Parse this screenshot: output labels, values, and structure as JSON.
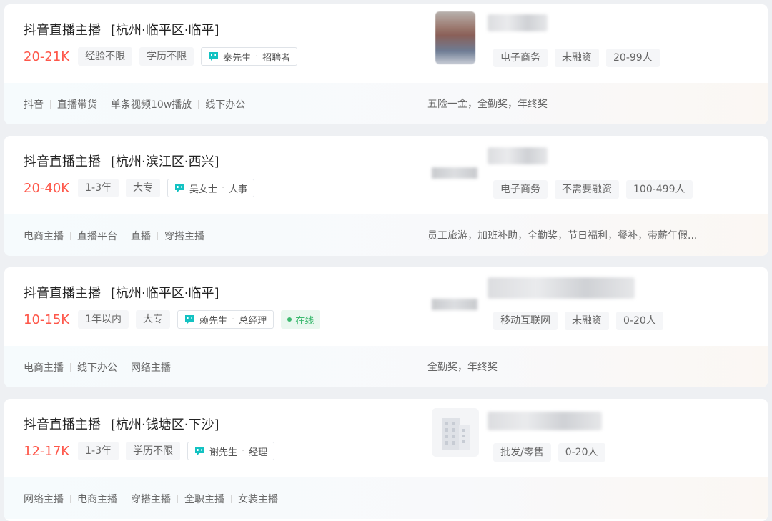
{
  "jobs": [
    {
      "title": "抖音直播主播",
      "location": "[杭州·临平区·临平]",
      "salary": "20-21K",
      "tags": [
        "经验不限",
        "学历不限"
      ],
      "recruiter": {
        "name": "秦先生",
        "role": "招聘者"
      },
      "online": null,
      "company": {
        "logo": "person-photo-blurred",
        "tags": [
          "电子商务",
          "未融资",
          "20-99人"
        ]
      },
      "skills": [
        "抖音",
        "直播带货",
        "单条视频10w播放",
        "线下办公"
      ],
      "benefits": "五险一金，全勤奖，年终奖"
    },
    {
      "title": "抖音直播主播",
      "location": "[杭州·滨江区·西兴]",
      "salary": "20-40K",
      "tags": [
        "1-3年",
        "大专"
      ],
      "recruiter": {
        "name": "吴女士",
        "role": "人事"
      },
      "online": null,
      "company": {
        "logo": "blurred-logo",
        "tags": [
          "电子商务",
          "不需要融资",
          "100-499人"
        ]
      },
      "skills": [
        "电商主播",
        "直播平台",
        "直播",
        "穿搭主播"
      ],
      "benefits": "员工旅游，加班补助，全勤奖，节日福利，餐补，带薪年假..."
    },
    {
      "title": "抖音直播主播",
      "location": "[杭州·临平区·临平]",
      "salary": "10-15K",
      "tags": [
        "1年以内",
        "大专"
      ],
      "recruiter": {
        "name": "赖先生",
        "role": "总经理"
      },
      "online": "在线",
      "company": {
        "logo": "blurred-logo",
        "tags": [
          "移动互联网",
          "未融资",
          "0-20人"
        ]
      },
      "skills": [
        "电商主播",
        "线下办公",
        "网络主播"
      ],
      "benefits": "全勤奖，年终奖"
    },
    {
      "title": "抖音直播主播",
      "location": "[杭州·钱塘区·下沙]",
      "salary": "12-17K",
      "tags": [
        "1-3年",
        "学历不限"
      ],
      "recruiter": {
        "name": "谢先生",
        "role": "经理"
      },
      "online": null,
      "company": {
        "logo": "building-icon",
        "tags": [
          "批发/零售",
          "0-20人"
        ]
      },
      "skills": [
        "网络主播",
        "电商主播",
        "穿搭主播",
        "全职主播",
        "女装主播"
      ],
      "benefits": ""
    }
  ],
  "colors": {
    "salary": "#fe574a",
    "chat_icon": "#13c2c2",
    "online": "#3cb96f"
  }
}
